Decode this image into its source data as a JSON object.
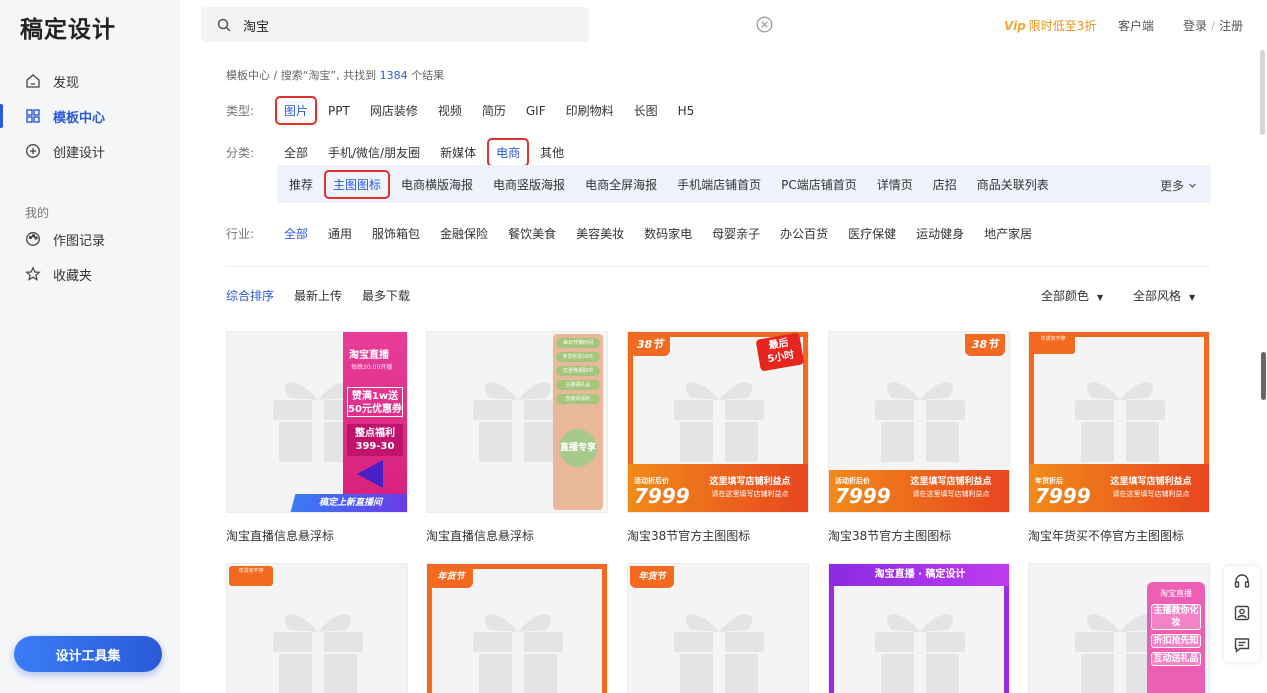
{
  "sidebar": {
    "logo": "稿定设计",
    "items": [
      {
        "label": "发现",
        "icon": "home-icon"
      },
      {
        "label": "模板中心",
        "icon": "grid-icon",
        "active": true
      },
      {
        "label": "创建设计",
        "icon": "plus-circle-icon"
      }
    ],
    "section_label": "我的",
    "my_items": [
      {
        "label": "作图记录",
        "icon": "palette-icon"
      },
      {
        "label": "收藏夹",
        "icon": "star-icon"
      }
    ],
    "toolbox_button": "设计工具集"
  },
  "header": {
    "search_value": "淘宝",
    "vip_label": "Vip",
    "promo": "限时低至3折",
    "client": "客户端",
    "login": "登录",
    "register": "注册",
    "login_sep": "/"
  },
  "breadcrumb": {
    "root": "模板中心",
    "sep": " / ",
    "prefix": "搜索“淘宝”, 共找到 ",
    "count": "1384",
    "suffix": " 个结果"
  },
  "filters": {
    "type": {
      "label": "类型:",
      "options": [
        "图片",
        "PPT",
        "网店装修",
        "视频",
        "简历",
        "GIF",
        "印刷物料",
        "长图",
        "H5"
      ],
      "selected": "图片"
    },
    "category": {
      "label": "分类:",
      "options": [
        "全部",
        "手机/微信/朋友圈",
        "新媒体",
        "电商",
        "其他"
      ],
      "selected": "电商"
    },
    "subcategory": {
      "options": [
        "推荐",
        "主图图标",
        "电商横版海报",
        "电商竖版海报",
        "电商全屏海报",
        "手机端店铺首页",
        "PC端店铺首页",
        "详情页",
        "店招",
        "商品关联列表"
      ],
      "selected": "主图图标",
      "more": "更多"
    },
    "industry": {
      "label": "行业:",
      "options": [
        "全部",
        "通用",
        "服饰箱包",
        "金融保险",
        "餐饮美食",
        "美容美妆",
        "数码家电",
        "母婴亲子",
        "办公百货",
        "医疗保健",
        "运动健身",
        "地产家居"
      ],
      "selected": "全部"
    }
  },
  "sort": {
    "options": [
      "综合排序",
      "最新上传",
      "最多下载"
    ],
    "selected": "综合排序",
    "color_filter": "全部颜色",
    "style_filter": "全部风格"
  },
  "cards_row1": [
    {
      "title": "淘宝直播信息悬浮标",
      "overlay": {
        "brand": "淘宝直播",
        "time": "每晚20:00开播",
        "deal": "赞满1w送",
        "deal2": "50元优惠券",
        "bonus": "整点福利",
        "bonus2": "399-30",
        "bar": "稿定上新直播间"
      }
    },
    {
      "title": "淘宝直播信息悬浮标",
      "overlay": {
        "pills": [
          "每日开播时间",
          "专享秒杀10元",
          "优惠券领取中",
          "主播福礼品",
          "直播间福利"
        ],
        "circle": "直播专享"
      }
    },
    {
      "title": "淘宝38节官方主图图标",
      "overlay": {
        "tag": "38节",
        "badge_top": "最后",
        "badge_bottom": "5小时",
        "price_label": "活动折后价",
        "price": "7999",
        "slogan": "这里填写店铺利益点",
        "slogan_sub": "请在这里填写店铺利益点"
      }
    },
    {
      "title": "淘宝38节官方主图图标",
      "overlay": {
        "tag": "38节",
        "price_label": "活动折后价",
        "price": "7999",
        "slogan": "这里填写店铺利益点",
        "slogan_sub": "请在这里填写店铺利益点"
      }
    },
    {
      "title": "淘宝年货买不停官方主图图标",
      "overlay": {
        "tag": "年货买不停",
        "price_label": "年货折后",
        "price": "7999",
        "slogan": "这里填写店铺利益点",
        "slogan_sub": "请在这里填写店铺利益点"
      }
    }
  ],
  "cards_row2": [
    {
      "overlay": {
        "tag": "年货买不停"
      }
    },
    {
      "overlay": {
        "tag": "年货节"
      }
    },
    {
      "overlay": {
        "tag": "年货节"
      }
    },
    {
      "overlay": {
        "top": "淘宝直播 · 稿定设计"
      }
    },
    {
      "overlay": {
        "brand": "淘宝直播",
        "b1": "主播教你化妆",
        "b2": "折扣抢先知",
        "b3": "互动送礼品"
      }
    }
  ]
}
